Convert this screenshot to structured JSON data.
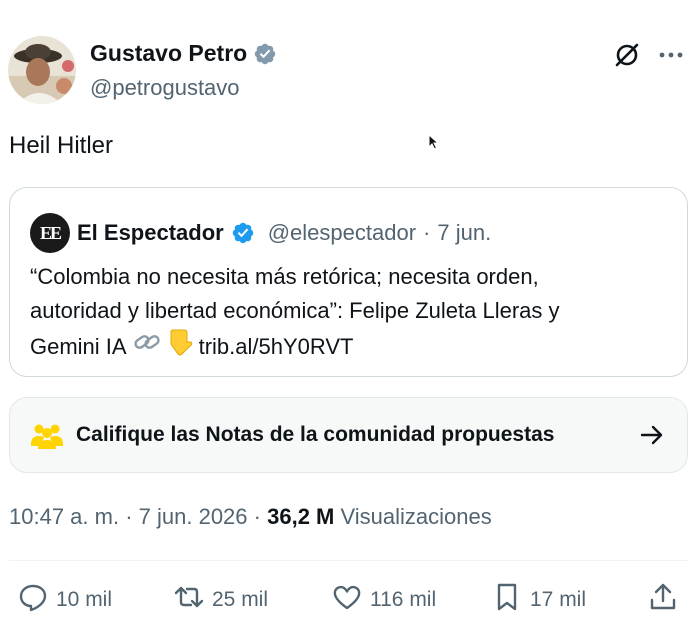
{
  "author": {
    "name": "Gustavo Petro",
    "handle": "@petrogustavo"
  },
  "tweet": {
    "text": "Heil Hitler"
  },
  "quoted": {
    "logo_text": "EE",
    "name": "El Espectador",
    "handle": "@elespectador",
    "separator": "·",
    "date": "7 jun.",
    "body_line1": "“Colombia no necesita más retórica; necesita orden,",
    "body_line2": "autoridad y libertad económica”: Felipe Zuleta Lleras y",
    "body_line3_text": "Gemini IA",
    "body_link": "trib.al/5hY0RVT"
  },
  "community_notes": {
    "label": "Califique las Notas de la comunidad propuestas"
  },
  "meta": {
    "time": "10:47 a. m.",
    "sep1": "·",
    "date": "7 jun. 2026",
    "sep2": "·",
    "views": "36,2 M",
    "views_label": "Visualizaciones"
  },
  "actions": {
    "replies": "10 mil",
    "reposts": "25 mil",
    "likes": "116 mil",
    "bookmarks": "17 mil"
  },
  "colors": {
    "verified": "#1d9bf0",
    "secondary_text": "#536471",
    "primary_text": "#0f1419",
    "people_icon": "#ffd400"
  },
  "icons": {
    "verified": "verified-badge-icon",
    "grok": "grok-icon",
    "more": "more-icon",
    "link": "link-emoji-icon",
    "pointing": "pointing-down-emoji-icon",
    "community": "people-icon",
    "arrow": "arrow-right-icon",
    "reply": "reply-icon",
    "repost": "repost-icon",
    "like": "heart-icon",
    "bookmark": "bookmark-icon",
    "share": "share-icon"
  }
}
